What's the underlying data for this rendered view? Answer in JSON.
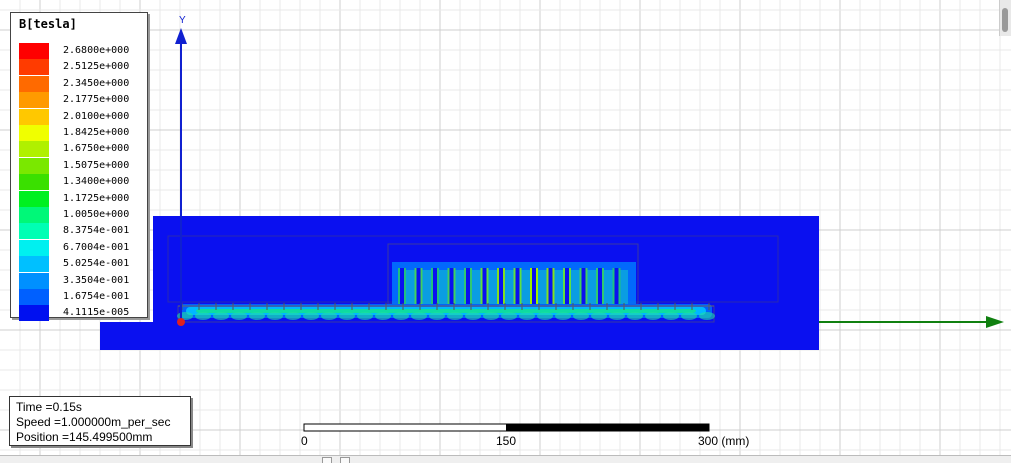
{
  "legend": {
    "title": "B[tesla]",
    "entries": [
      {
        "label": "2.6800e+000",
        "color": "#ff0000"
      },
      {
        "label": "2.5125e+000",
        "color": "#ff3b00"
      },
      {
        "label": "2.3450e+000",
        "color": "#ff6a00"
      },
      {
        "label": "2.1775e+000",
        "color": "#ff9a00"
      },
      {
        "label": "2.0100e+000",
        "color": "#ffc800"
      },
      {
        "label": "1.8425e+000",
        "color": "#f0ff00"
      },
      {
        "label": "1.6750e+000",
        "color": "#b0f000"
      },
      {
        "label": "1.5075e+000",
        "color": "#7ae800"
      },
      {
        "label": "1.3400e+000",
        "color": "#3ae000"
      },
      {
        "label": "1.1725e+000",
        "color": "#00f020"
      },
      {
        "label": "1.0050e+000",
        "color": "#00f878"
      },
      {
        "label": "8.3754e-001",
        "color": "#00ffb4"
      },
      {
        "label": "6.7004e-001",
        "color": "#00f0f0"
      },
      {
        "label": "5.0254e-001",
        "color": "#00c0ff"
      },
      {
        "label": "3.3504e-001",
        "color": "#0090ff"
      },
      {
        "label": "1.6754e-001",
        "color": "#0060ff"
      },
      {
        "label": "4.1115e-005",
        "color": "#0010f0"
      }
    ]
  },
  "info": {
    "time": "Time    =0.15s",
    "speed": "Speed   =1.000000m_per_sec",
    "position": "Position =145.499500mm"
  },
  "axes": {
    "y_label": "Y",
    "axis_blue": "#1020d0",
    "axis_green": "#108010"
  },
  "scale_bar": {
    "labels": [
      "0",
      "150",
      "300 (mm)"
    ]
  },
  "colors": {
    "field_bg": "#0a10f0",
    "outline": "#444444"
  }
}
